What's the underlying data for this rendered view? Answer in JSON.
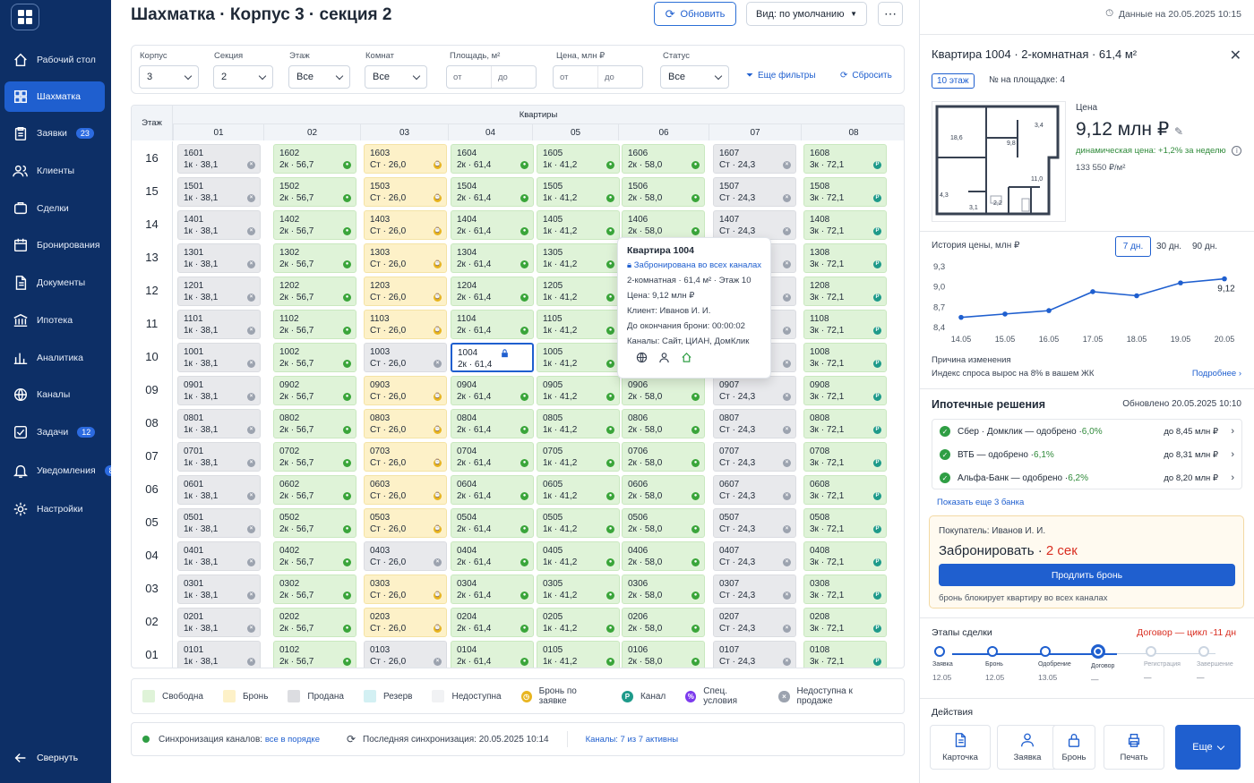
{
  "sidebar": {
    "items": [
      {
        "label": "Рабочий стол",
        "icon": "home-icon"
      },
      {
        "label": "Шахматка",
        "icon": "grid-icon",
        "active": true
      },
      {
        "label": "Заявки",
        "icon": "clipboard-icon",
        "badge": "23"
      },
      {
        "label": "Клиенты",
        "icon": "users-icon"
      },
      {
        "label": "Сделки",
        "icon": "deal-icon"
      },
      {
        "label": "Бронирования",
        "icon": "calendar-icon"
      },
      {
        "label": "Документы",
        "icon": "document-icon"
      },
      {
        "label": "Ипотека",
        "icon": "bank-icon"
      },
      {
        "label": "Аналитика",
        "icon": "chart-icon"
      },
      {
        "label": "Каналы",
        "icon": "channels-icon"
      },
      {
        "label": "Задачи",
        "icon": "task-icon",
        "badge": "12"
      },
      {
        "label": "Уведомления",
        "icon": "bell-icon",
        "badge": "8"
      },
      {
        "label": "Настройки",
        "icon": "gear-icon"
      }
    ],
    "collapse_label": "Свернуть"
  },
  "header": {
    "title": "Шахматка · Корпус 3 · секция 2",
    "refresh_label": "Обновить",
    "view_label": "Вид: по умолчанию"
  },
  "filters": {
    "korpus": {
      "label": "Корпус",
      "value": "3"
    },
    "sekciya": {
      "label": "Секция",
      "value": "2"
    },
    "etazh": {
      "label": "Этаж",
      "value": "Все"
    },
    "komnat": {
      "label": "Комнат",
      "value": "Все"
    },
    "ploshad": {
      "label": "Площадь, м²",
      "from": "от",
      "to": "до"
    },
    "cena": {
      "label": "Цена, млн ₽",
      "from": "от",
      "to": "до"
    },
    "status": {
      "label": "Статус",
      "value": "Все"
    },
    "more_label": "Еще фильтры",
    "reset_label": "Сбросить"
  },
  "grid": {
    "floor_header": "Этаж",
    "apartments_header": "Квартиры",
    "columns": [
      "01",
      "02",
      "03",
      "04",
      "05",
      "06",
      "07",
      "08"
    ],
    "floors": [
      "16",
      "15",
      "14",
      "13",
      "12",
      "11",
      "10",
      "09",
      "08",
      "07",
      "06",
      "05",
      "04",
      "03",
      "02",
      "01"
    ],
    "types": [
      "1к · 38,1",
      "2к · 56,7",
      "Ст · 26,0",
      "2к · 61,4",
      "1к · 41,2",
      "2к · 58,0",
      "Ст · 24,3",
      "3к · 72,1"
    ]
  },
  "tooltip": {
    "title": "Квартира 1004",
    "status": "Забронирована во всех каналах",
    "info": "2-комнатная · 61,4 м² · Этаж 10",
    "price": "Цена: 9,12 млн ₽",
    "client": "Клиент: Иванов И. И.",
    "timer": "До окончания брони: 00:00:02",
    "channels": "Каналы: Сайт, ЦИАН, ДомКлик"
  },
  "legend": [
    {
      "label": "Свободна",
      "color": "#dff3d8"
    },
    {
      "label": "Бронь",
      "color": "#fdf1c8"
    },
    {
      "label": "Продана",
      "color": "#dcdde1"
    },
    {
      "label": "Резерв",
      "color": "#d3f0f3"
    },
    {
      "label": "Недоступна",
      "color": "#f1f2f4"
    },
    {
      "label": "Бронь по заявке",
      "icon": "clock-icon"
    },
    {
      "label": "Канал",
      "icon": "channel-p-icon"
    },
    {
      "label": "Спец. условия",
      "icon": "percent-icon"
    },
    {
      "label": "Недоступна к продаже",
      "icon": "x-circle-icon"
    }
  ],
  "sync": {
    "label": "Синхронизация каналов:",
    "status": "все в порядке",
    "last": "Последняя синхронизация: 20.05.2025 10:14",
    "channels": "Каналы: 7 из 7 активны"
  },
  "right": {
    "data_date": "Данные на 20.05.2025 10:15",
    "title": "Квартира 1004 · 2-комнатная · 61,4 м²",
    "floor_badge": "10 этаж",
    "platform_num": "№ на площадке: 4",
    "price_label": "Цена",
    "price_value": "9,12 млн ₽",
    "dynamic": "динамическая цена: +1,2% за неделю",
    "ppm": "133 550 ₽/м²",
    "plan_labels": [
      "18,6",
      "9,8",
      "3,4",
      "11,0",
      "4,3",
      "3,1",
      "2,2"
    ],
    "history_title": "История цены, млн ₽",
    "tabs": [
      "7 дн.",
      "30 дн.",
      "90 дн."
    ],
    "reason_label": "Причина изменения",
    "reason_text": "Индекс спроса вырос на 8% в вашем ЖК",
    "more_link": "Подробнее",
    "mortgage_title": "Ипотечные решения",
    "mortgage_updated": "Обновлено 20.05.2025 10:10",
    "banks": [
      {
        "name": "Сбер · Домклик — одобрено · ",
        "rate": "6,0%",
        "amount": "до 8,45 млн ₽"
      },
      {
        "name": "ВТБ — одобрено · ",
        "rate": "6,1%",
        "amount": "до 8,31 млн ₽"
      },
      {
        "name": "Альфа-Банк — одобрено · ",
        "rate": "6,2%",
        "amount": "до 8,20 млн ₽"
      }
    ],
    "show_more_banks": "Показать еще 3 банка",
    "buyer": "Покупатель: Иванов И. И.",
    "book_label": "Забронировать · ",
    "book_timer": "2 сек",
    "extend_label": "Продлить бронь",
    "book_note": "бронь блокирует квартиру во всех каналах",
    "steps_title": "Этапы сделки",
    "steps_cycle": "Договор — цикл -11 дн",
    "steps": [
      {
        "name": "Заявка",
        "date": "12.05"
      },
      {
        "name": "Бронь",
        "date": "12.05"
      },
      {
        "name": "Одобрение",
        "date": "13.05"
      },
      {
        "name": "Договор",
        "date": "—"
      },
      {
        "name": "Регистрация",
        "date": "—"
      },
      {
        "name": "Завершение",
        "date": "—"
      }
    ],
    "actions_title": "Действия",
    "actions": [
      "Карточка",
      "Заявка",
      "Бронь",
      "Печать"
    ],
    "actions_more": "Еще"
  },
  "chart_data": {
    "type": "line",
    "x": [
      "14.05",
      "15.05",
      "16.05",
      "17.05",
      "18.05",
      "19.05",
      "20.05"
    ],
    "values": [
      8.55,
      8.6,
      8.65,
      8.93,
      8.87,
      9.06,
      9.12
    ],
    "yticks": [
      "9,3",
      "9,0",
      "8,7",
      "8,4"
    ],
    "ylim": [
      8.4,
      9.3
    ],
    "last_label": "9,12",
    "color": "#1f5fcf"
  }
}
